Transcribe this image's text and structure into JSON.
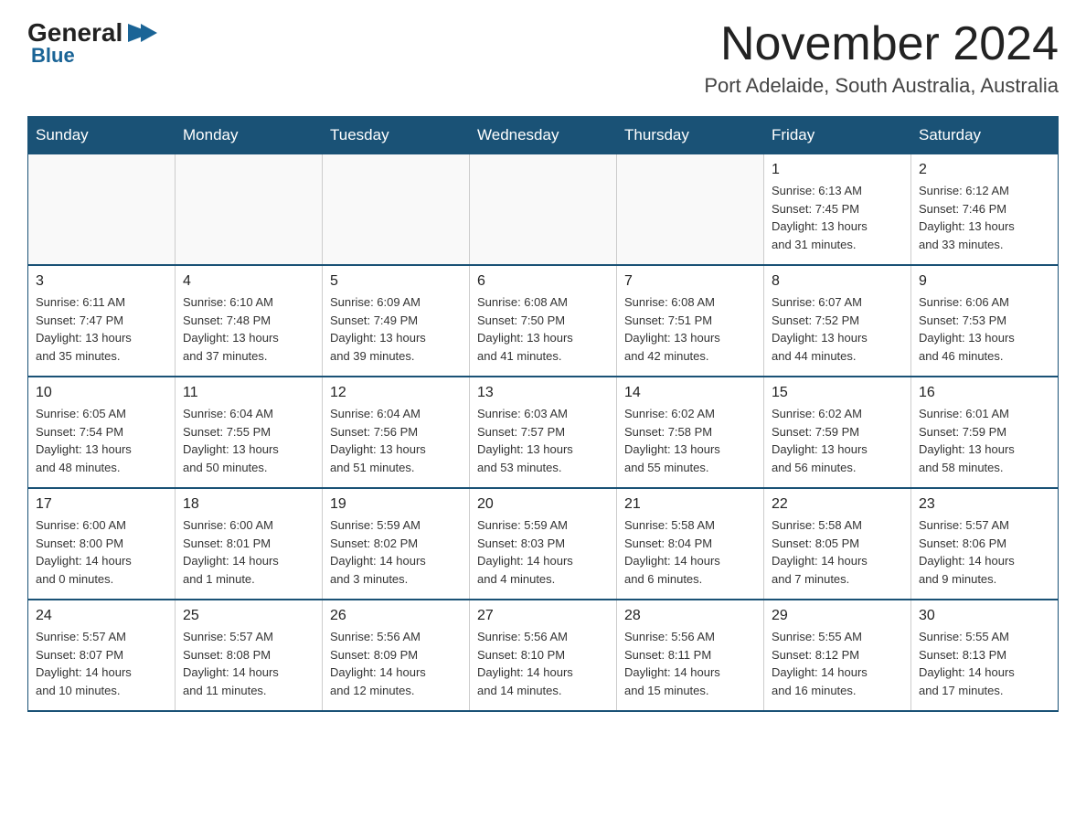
{
  "logo": {
    "general": "General",
    "arrow": "▶",
    "blue": "Blue"
  },
  "title": {
    "month": "November 2024",
    "location": "Port Adelaide, South Australia, Australia"
  },
  "weekdays": [
    "Sunday",
    "Monday",
    "Tuesday",
    "Wednesday",
    "Thursday",
    "Friday",
    "Saturday"
  ],
  "rows": [
    {
      "cells": [
        {
          "day": "",
          "info": ""
        },
        {
          "day": "",
          "info": ""
        },
        {
          "day": "",
          "info": ""
        },
        {
          "day": "",
          "info": ""
        },
        {
          "day": "",
          "info": ""
        },
        {
          "day": "1",
          "info": "Sunrise: 6:13 AM\nSunset: 7:45 PM\nDaylight: 13 hours\nand 31 minutes."
        },
        {
          "day": "2",
          "info": "Sunrise: 6:12 AM\nSunset: 7:46 PM\nDaylight: 13 hours\nand 33 minutes."
        }
      ]
    },
    {
      "cells": [
        {
          "day": "3",
          "info": "Sunrise: 6:11 AM\nSunset: 7:47 PM\nDaylight: 13 hours\nand 35 minutes."
        },
        {
          "day": "4",
          "info": "Sunrise: 6:10 AM\nSunset: 7:48 PM\nDaylight: 13 hours\nand 37 minutes."
        },
        {
          "day": "5",
          "info": "Sunrise: 6:09 AM\nSunset: 7:49 PM\nDaylight: 13 hours\nand 39 minutes."
        },
        {
          "day": "6",
          "info": "Sunrise: 6:08 AM\nSunset: 7:50 PM\nDaylight: 13 hours\nand 41 minutes."
        },
        {
          "day": "7",
          "info": "Sunrise: 6:08 AM\nSunset: 7:51 PM\nDaylight: 13 hours\nand 42 minutes."
        },
        {
          "day": "8",
          "info": "Sunrise: 6:07 AM\nSunset: 7:52 PM\nDaylight: 13 hours\nand 44 minutes."
        },
        {
          "day": "9",
          "info": "Sunrise: 6:06 AM\nSunset: 7:53 PM\nDaylight: 13 hours\nand 46 minutes."
        }
      ]
    },
    {
      "cells": [
        {
          "day": "10",
          "info": "Sunrise: 6:05 AM\nSunset: 7:54 PM\nDaylight: 13 hours\nand 48 minutes."
        },
        {
          "day": "11",
          "info": "Sunrise: 6:04 AM\nSunset: 7:55 PM\nDaylight: 13 hours\nand 50 minutes."
        },
        {
          "day": "12",
          "info": "Sunrise: 6:04 AM\nSunset: 7:56 PM\nDaylight: 13 hours\nand 51 minutes."
        },
        {
          "day": "13",
          "info": "Sunrise: 6:03 AM\nSunset: 7:57 PM\nDaylight: 13 hours\nand 53 minutes."
        },
        {
          "day": "14",
          "info": "Sunrise: 6:02 AM\nSunset: 7:58 PM\nDaylight: 13 hours\nand 55 minutes."
        },
        {
          "day": "15",
          "info": "Sunrise: 6:02 AM\nSunset: 7:59 PM\nDaylight: 13 hours\nand 56 minutes."
        },
        {
          "day": "16",
          "info": "Sunrise: 6:01 AM\nSunset: 7:59 PM\nDaylight: 13 hours\nand 58 minutes."
        }
      ]
    },
    {
      "cells": [
        {
          "day": "17",
          "info": "Sunrise: 6:00 AM\nSunset: 8:00 PM\nDaylight: 14 hours\nand 0 minutes."
        },
        {
          "day": "18",
          "info": "Sunrise: 6:00 AM\nSunset: 8:01 PM\nDaylight: 14 hours\nand 1 minute."
        },
        {
          "day": "19",
          "info": "Sunrise: 5:59 AM\nSunset: 8:02 PM\nDaylight: 14 hours\nand 3 minutes."
        },
        {
          "day": "20",
          "info": "Sunrise: 5:59 AM\nSunset: 8:03 PM\nDaylight: 14 hours\nand 4 minutes."
        },
        {
          "day": "21",
          "info": "Sunrise: 5:58 AM\nSunset: 8:04 PM\nDaylight: 14 hours\nand 6 minutes."
        },
        {
          "day": "22",
          "info": "Sunrise: 5:58 AM\nSunset: 8:05 PM\nDaylight: 14 hours\nand 7 minutes."
        },
        {
          "day": "23",
          "info": "Sunrise: 5:57 AM\nSunset: 8:06 PM\nDaylight: 14 hours\nand 9 minutes."
        }
      ]
    },
    {
      "cells": [
        {
          "day": "24",
          "info": "Sunrise: 5:57 AM\nSunset: 8:07 PM\nDaylight: 14 hours\nand 10 minutes."
        },
        {
          "day": "25",
          "info": "Sunrise: 5:57 AM\nSunset: 8:08 PM\nDaylight: 14 hours\nand 11 minutes."
        },
        {
          "day": "26",
          "info": "Sunrise: 5:56 AM\nSunset: 8:09 PM\nDaylight: 14 hours\nand 12 minutes."
        },
        {
          "day": "27",
          "info": "Sunrise: 5:56 AM\nSunset: 8:10 PM\nDaylight: 14 hours\nand 14 minutes."
        },
        {
          "day": "28",
          "info": "Sunrise: 5:56 AM\nSunset: 8:11 PM\nDaylight: 14 hours\nand 15 minutes."
        },
        {
          "day": "29",
          "info": "Sunrise: 5:55 AM\nSunset: 8:12 PM\nDaylight: 14 hours\nand 16 minutes."
        },
        {
          "day": "30",
          "info": "Sunrise: 5:55 AM\nSunset: 8:13 PM\nDaylight: 14 hours\nand 17 minutes."
        }
      ]
    }
  ]
}
